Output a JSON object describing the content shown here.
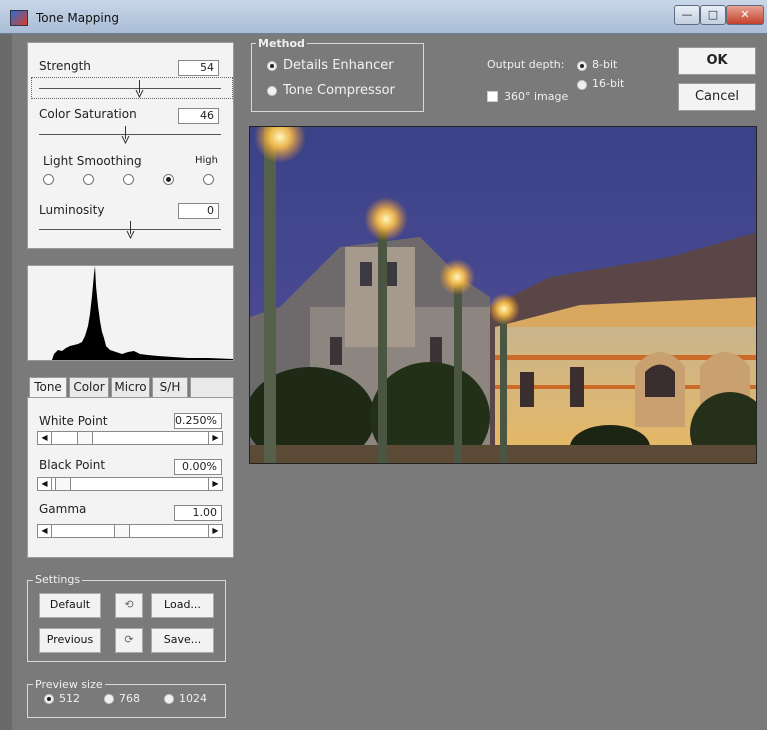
{
  "window": {
    "title": "Tone Mapping"
  },
  "adjust": {
    "strength": {
      "label": "Strength",
      "value": "54",
      "pos": 0.55
    },
    "color_saturation": {
      "label": "Color Saturation",
      "value": "46",
      "pos": 0.47
    },
    "light_smoothing": {
      "label": "Light Smoothing",
      "high_label": "High",
      "selected_index": 3,
      "count": 5
    },
    "luminosity": {
      "label": "Luminosity",
      "value": "0",
      "pos": 0.5
    }
  },
  "tabs": [
    {
      "label": "Tone",
      "active": true
    },
    {
      "label": "Color",
      "active": false
    },
    {
      "label": "Micro",
      "active": false
    },
    {
      "label": "S/H",
      "active": false
    }
  ],
  "tone": {
    "white_point": {
      "label": "White Point",
      "value": "0.250%",
      "pos": 0.18
    },
    "black_point": {
      "label": "Black Point",
      "value": "0.00%",
      "pos": 0.03
    },
    "gamma": {
      "label": "Gamma",
      "value": "1.00",
      "pos": 0.44
    }
  },
  "settings": {
    "label": "Settings",
    "default_label": "Default",
    "load_label": "Load...",
    "previous_label": "Previous",
    "save_label": "Save..."
  },
  "preview_size": {
    "label": "Preview size",
    "options": [
      "512",
      "768",
      "1024"
    ],
    "selected": "512"
  },
  "method": {
    "label": "Method",
    "options": [
      "Details Enhancer",
      "Tone Compressor"
    ],
    "selected": "Details Enhancer"
  },
  "output": {
    "depth_label": "Output depth:",
    "depth_8": "8-bit",
    "depth_16": "16-bit",
    "selected": "8-bit",
    "image_360_label": "360° image",
    "image_360_checked": false
  },
  "buttons": {
    "ok": "OK",
    "cancel": "Cancel"
  },
  "colors": {
    "background": "#7a7a7a",
    "panel": "#f3f3f3",
    "titlebar": "#b9cadf"
  }
}
